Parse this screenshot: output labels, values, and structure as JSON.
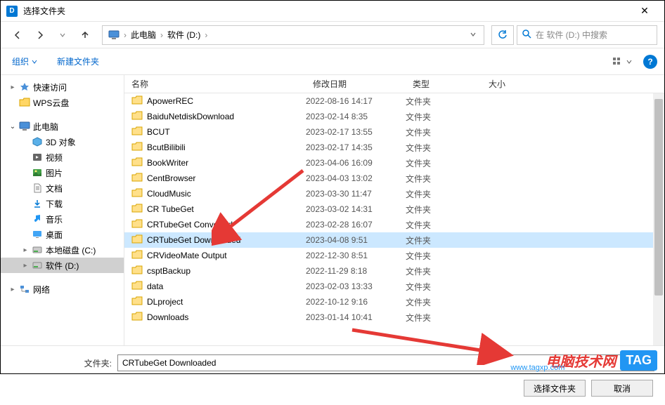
{
  "window": {
    "title": "选择文件夹"
  },
  "breadcrumb": {
    "pc": "此电脑",
    "drive": "软件 (D:)"
  },
  "search": {
    "placeholder": "在 软件 (D:) 中搜索"
  },
  "toolbar": {
    "organize": "组织",
    "newfolder": "新建文件夹"
  },
  "columns": {
    "name": "名称",
    "date": "修改日期",
    "type": "类型",
    "size": "大小"
  },
  "sidebar": {
    "quick": "快速访问",
    "wps": "WPS云盘",
    "thispc": "此电脑",
    "objects3d": "3D 对象",
    "video": "视频",
    "image": "图片",
    "doc": "文档",
    "download": "下载",
    "music": "音乐",
    "desktop": "桌面",
    "localc": "本地磁盘 (C:)",
    "software": "软件 (D:)",
    "network": "网络"
  },
  "type_folder": "文件夹",
  "files": [
    {
      "name": "ApowerREC",
      "date": "2022-08-16 14:17"
    },
    {
      "name": "BaiduNetdiskDownload",
      "date": "2023-02-14 8:35"
    },
    {
      "name": "BCUT",
      "date": "2023-02-17 13:55"
    },
    {
      "name": "BcutBilibili",
      "date": "2023-02-17 14:35"
    },
    {
      "name": "BookWriter",
      "date": "2023-04-06 16:09"
    },
    {
      "name": "CentBrowser",
      "date": "2023-04-03 13:02"
    },
    {
      "name": "CloudMusic",
      "date": "2023-03-30 11:47"
    },
    {
      "name": "CR TubeGet",
      "date": "2023-03-02 14:31"
    },
    {
      "name": "CRTubeGet Converted",
      "date": "2023-02-28 16:07"
    },
    {
      "name": "CRTubeGet Downloaded",
      "date": "2023-04-08 9:51",
      "selected": true
    },
    {
      "name": "CRVideoMate Output",
      "date": "2022-12-30 8:51"
    },
    {
      "name": "csptBackup",
      "date": "2022-11-29 8:18"
    },
    {
      "name": "data",
      "date": "2023-02-03 13:33"
    },
    {
      "name": "DLproject",
      "date": "2022-10-12 9:16"
    },
    {
      "name": "Downloads",
      "date": "2023-01-14 10:41"
    }
  ],
  "footer": {
    "label": "文件夹:",
    "value": "CRTubeGet Downloaded",
    "select": "选择文件夹",
    "cancel": "取消"
  },
  "watermark": {
    "text": "电脑技术网",
    "tag": "TAG",
    "url": "www.tagxp.com"
  }
}
